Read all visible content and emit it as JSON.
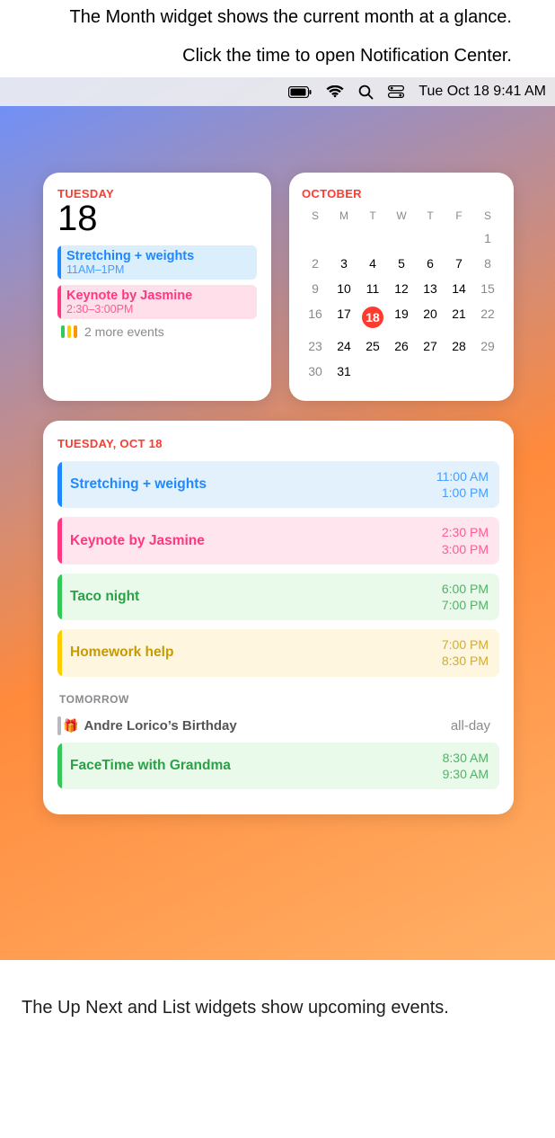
{
  "annotations": {
    "top1": "The Month widget shows the current month at a glance.",
    "top2": "Click the time to open Notification Center.",
    "bottom": "The Up Next and List widgets show upcoming events."
  },
  "menubar": {
    "clock": "Tue Oct 18  9:41 AM"
  },
  "upnext": {
    "day_label": "TUESDAY",
    "day_number": "18",
    "events": [
      {
        "title": "Stretching + weights",
        "time": "11AM–1PM",
        "color": "blue"
      },
      {
        "title": "Keynote by Jasmine",
        "time": "2:30–3:00PM",
        "color": "pink"
      }
    ],
    "more_text": "2 more events"
  },
  "month": {
    "label": "OCTOBER",
    "weekdays": [
      "S",
      "M",
      "T",
      "W",
      "T",
      "F",
      "S"
    ],
    "weeks": [
      [
        "",
        "",
        "",
        "",
        "",
        "",
        "1"
      ],
      [
        "2",
        "3",
        "4",
        "5",
        "6",
        "7",
        "8"
      ],
      [
        "9",
        "10",
        "11",
        "12",
        "13",
        "14",
        "15"
      ],
      [
        "16",
        "17",
        "18",
        "19",
        "20",
        "21",
        "22"
      ],
      [
        "23",
        "24",
        "25",
        "26",
        "27",
        "28",
        "29"
      ],
      [
        "30",
        "31",
        "",
        "",
        "",
        "",
        ""
      ]
    ],
    "today": "18"
  },
  "list": {
    "header": "TUESDAY, OCT 18",
    "today_events": [
      {
        "title": "Stretching + weights",
        "start": "11:00 AM",
        "end": "1:00 PM",
        "color": "blue"
      },
      {
        "title": "Keynote by Jasmine",
        "start": "2:30 PM",
        "end": "3:00 PM",
        "color": "pink"
      },
      {
        "title": "Taco night",
        "start": "6:00 PM",
        "end": "7:00 PM",
        "color": "green"
      },
      {
        "title": "Homework help",
        "start": "7:00 PM",
        "end": "8:30 PM",
        "color": "yellow"
      }
    ],
    "tomorrow_label": "TOMORROW",
    "tomorrow_events": [
      {
        "title": "Andre Lorico’s Birthday",
        "allday": "all-day",
        "type": "birthday"
      },
      {
        "title": "FaceTime with Grandma",
        "start": "8:30 AM",
        "end": "9:30 AM",
        "color": "green"
      }
    ]
  }
}
